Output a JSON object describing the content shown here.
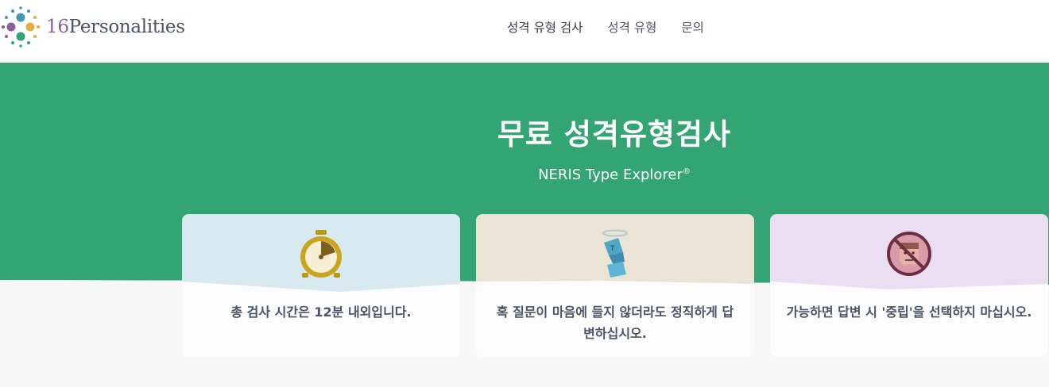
{
  "header": {
    "logo": {
      "number": "16",
      "word": "Personalities"
    },
    "nav": [
      {
        "label": "성격 유형 검사"
      },
      {
        "label": "성격 유형"
      },
      {
        "label": "문의"
      }
    ]
  },
  "hero": {
    "title": "무료 성격유형검사",
    "subtitle": "NERIS Type Explorer",
    "subtitle_mark": "®"
  },
  "cards": [
    {
      "text": "총 검사 시간은 12분 내외입니다.",
      "icon": "stopwatch-icon",
      "color": "#d9e9f0"
    },
    {
      "text": "혹 질문이 마음에 들지 않더라도 정직하게 답변하십시오.",
      "icon": "honest-figure-icon",
      "color": "#ebe4d6"
    },
    {
      "text": "가능하면 답변 시 '중립'을 선택하지 마십시오.",
      "icon": "no-neutral-face-icon",
      "color": "#ebdef3"
    }
  ],
  "colors": {
    "hero_green": "#33a474",
    "text": "#4c5366",
    "brand_purple": "#88619a"
  }
}
